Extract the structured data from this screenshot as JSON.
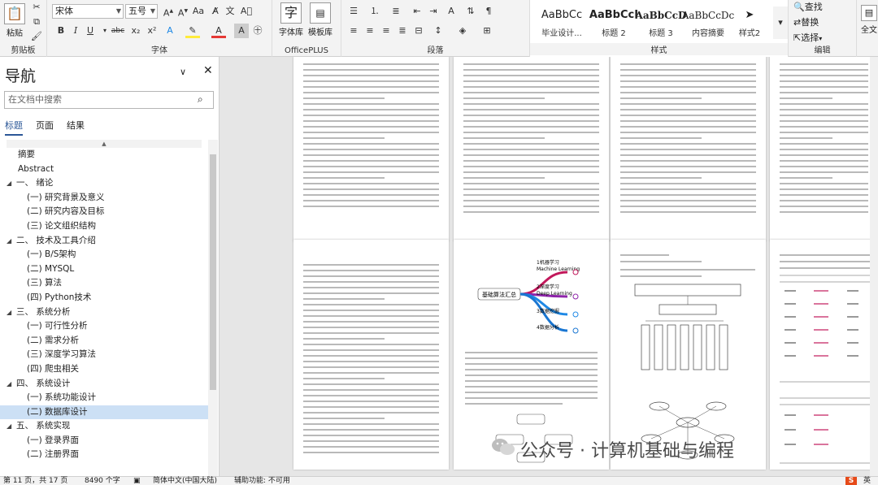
{
  "ribbon": {
    "paste": "粘贴",
    "clipboard_label": "剪贴板",
    "font_name": "宋体",
    "font_size": "五号",
    "font_label": "字体",
    "fontlib": "字体库",
    "template_lib": "模板库",
    "officeplus_label": "OfficePLUS",
    "paragraph_label": "段落",
    "styles_label": "样式",
    "styles": [
      {
        "sample": "AaBbCc",
        "name": "毕业设计..."
      },
      {
        "sample": "AaBbCcI",
        "name": "标题 2"
      },
      {
        "sample": "AaBbCcD",
        "name": "标题 3"
      },
      {
        "sample": "AaBbCcDc",
        "name": "内容摘要"
      },
      {
        "sample": "➤",
        "name": "样式2"
      }
    ],
    "find": "查找",
    "replace": "替换",
    "select": "选择",
    "editing_label": "编辑",
    "fulltext": "全文"
  },
  "nav": {
    "title": "导航",
    "search_placeholder": "在文档中搜索",
    "tabs": [
      "标题",
      "页面",
      "结果"
    ],
    "items": [
      {
        "text": "摘要",
        "level": 1,
        "arrow": ""
      },
      {
        "text": "Abstract",
        "level": 1,
        "arrow": ""
      },
      {
        "text": "一、 绪论",
        "level": 1,
        "arrow": "◢"
      },
      {
        "text": "(一) 研究背景及意义",
        "level": 2,
        "arrow": ""
      },
      {
        "text": "(二) 研究内容及目标",
        "level": 2,
        "arrow": ""
      },
      {
        "text": "(三) 论文组织结构",
        "level": 2,
        "arrow": ""
      },
      {
        "text": "二、 技术及工具介绍",
        "level": 1,
        "arrow": "◢"
      },
      {
        "text": "(一) B/S架构",
        "level": 2,
        "arrow": ""
      },
      {
        "text": "(二) MYSQL",
        "level": 2,
        "arrow": ""
      },
      {
        "text": "(三) 算法",
        "level": 2,
        "arrow": ""
      },
      {
        "text": "(四) Python技术",
        "level": 2,
        "arrow": ""
      },
      {
        "text": "三、 系统分析",
        "level": 1,
        "arrow": "◢"
      },
      {
        "text": "(一) 可行性分析",
        "level": 2,
        "arrow": ""
      },
      {
        "text": "(二) 需求分析",
        "level": 2,
        "arrow": ""
      },
      {
        "text": "(三) 深度学习算法",
        "level": 2,
        "arrow": ""
      },
      {
        "text": "(四) 爬虫相关",
        "level": 2,
        "arrow": ""
      },
      {
        "text": "四、 系统设计",
        "level": 1,
        "arrow": "◢"
      },
      {
        "text": "(一) 系统功能设计",
        "level": 2,
        "arrow": ""
      },
      {
        "text": "(二) 数据库设计",
        "level": 2,
        "arrow": "",
        "selected": true
      },
      {
        "text": "五、 系统实现",
        "level": 1,
        "arrow": "◢"
      },
      {
        "text": "(一) 登录界面",
        "level": 2,
        "arrow": ""
      },
      {
        "text": "(二) 注册界面",
        "level": 2,
        "arrow": ""
      }
    ]
  },
  "pages": {
    "mindmap_center": "基础算法汇总",
    "mindmap_branches": [
      "1机器学习",
      "Machine Learning",
      "2深度学习",
      "Deep Learning",
      "3数据挖掘",
      "4数据分析"
    ]
  },
  "status": {
    "page": "第 11 页，共 17 页",
    "words": "8490 个字",
    "lang": "简体中文(中国大陆)",
    "accessibility": "辅助功能: 不可用",
    "ime": "英"
  },
  "watermark": "公众号 · 计算机基础与编程",
  "colors": {
    "accent": "#2b5797",
    "selected": "#cce0f5",
    "mindmap1": "#c2185b",
    "mindmap2": "#1e88e5"
  }
}
